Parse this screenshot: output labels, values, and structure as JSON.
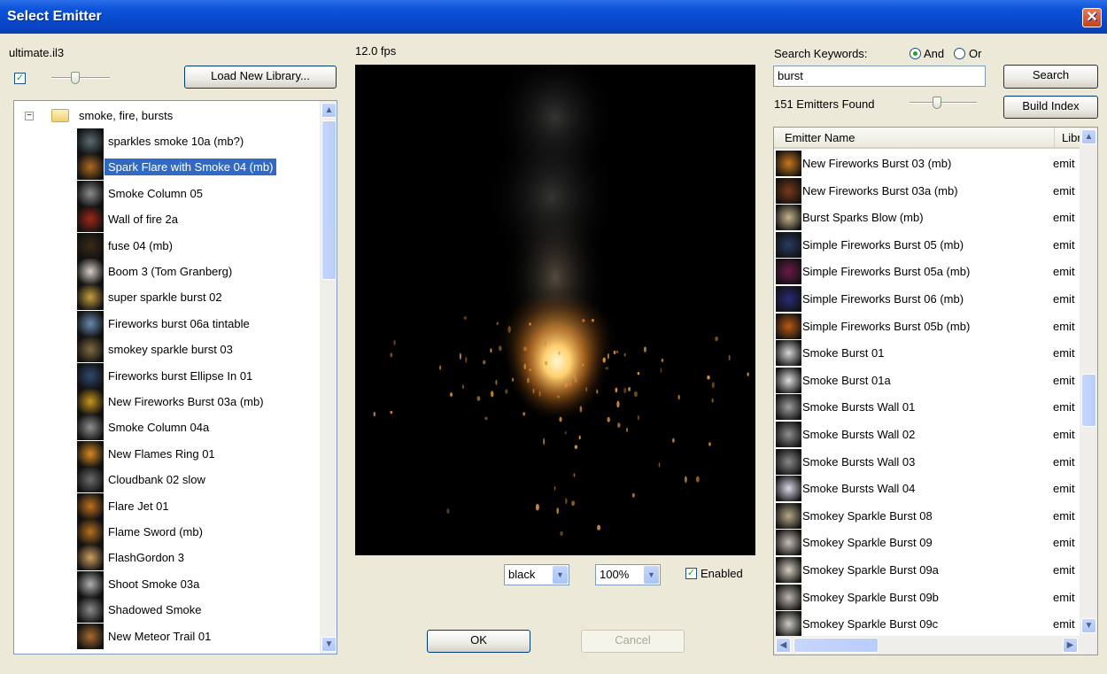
{
  "window": {
    "title": "Select Emitter",
    "close_glyph": "✕"
  },
  "library": {
    "file_name": "ultimate.il3",
    "show_thumbnails_checked": true,
    "thumbnail_size_level": 0.4,
    "load_button": "Load New Library...",
    "folder": {
      "label": "smoke, fire, bursts",
      "expanded": true
    },
    "items": [
      {
        "label": "sparkles smoke 10a (mb?)",
        "thumb": "#5b6c74"
      },
      {
        "label": "Spark Flare with Smoke 04 (mb)",
        "thumb": "#b06a22",
        "selected": true
      },
      {
        "label": "Smoke Column 05",
        "thumb": "#8c8c8c"
      },
      {
        "label": "Wall of fire 2a",
        "thumb": "#a02818"
      },
      {
        "label": "fuse 04 (mb)",
        "thumb": "#3a2a18"
      },
      {
        "label": "Boom 3 (Tom Granberg)",
        "thumb": "#d8d0c4"
      },
      {
        "label": "super sparkle burst 02",
        "thumb": "#c8a040"
      },
      {
        "label": "Fireworks burst 06a tintable",
        "thumb": "#6a8ab0"
      },
      {
        "label": "smokey sparkle burst 03",
        "thumb": "#806a40"
      },
      {
        "label": "Fireworks burst Ellipse In 01",
        "thumb": "#304a70"
      },
      {
        "label": "New Fireworks Burst 03a (mb)",
        "thumb": "#c8961e"
      },
      {
        "label": "Smoke Column 04a",
        "thumb": "#909090"
      },
      {
        "label": "New Flames Ring 01",
        "thumb": "#d88a20"
      },
      {
        "label": "Cloudbank 02 slow",
        "thumb": "#6c6c6c"
      },
      {
        "label": "Flare Jet 01",
        "thumb": "#c07020"
      },
      {
        "label": "Flame Sword  (mb)",
        "thumb": "#b87020"
      },
      {
        "label": "FlashGordon 3",
        "thumb": "#d0a060"
      },
      {
        "label": "Shoot Smoke 03a",
        "thumb": "#b0b0b0"
      },
      {
        "label": "Shadowed Smoke",
        "thumb": "#8a8a8a"
      },
      {
        "label": "New Meteor Trail 01",
        "thumb": "#a86a30"
      }
    ]
  },
  "preview": {
    "fps": "12.0 fps",
    "background_select": "black",
    "zoom_select": "100%",
    "enabled_label": "Enabled",
    "enabled_checked": true
  },
  "dialog_buttons": {
    "ok": "OK",
    "cancel": "Cancel"
  },
  "search": {
    "keywords_label": "Search Keywords:",
    "and_label": "And",
    "or_label": "Or",
    "mode": "And",
    "query": "burst",
    "search_button": "Search",
    "found_text": "151 Emitters Found",
    "thumbnail_size_level": 0.4,
    "build_index_button": "Build Index"
  },
  "results": {
    "columns": [
      "Emitter Name",
      "Libr"
    ],
    "rows": [
      {
        "name": "New Fireworks Burst 03 (mb)",
        "lib": "emit",
        "thumb": "#c8781e"
      },
      {
        "name": "New Fireworks Burst 03a (mb)",
        "lib": "emit",
        "thumb": "#7a3a18"
      },
      {
        "name": "Burst Sparks Blow (mb)",
        "lib": "emit",
        "thumb": "#c8b48c"
      },
      {
        "name": "Simple Fireworks Burst 05 (mb)",
        "lib": "emit",
        "thumb": "#283c64"
      },
      {
        "name": "Simple Fireworks Burst 05a (mb)",
        "lib": "emit",
        "thumb": "#6a1a4a"
      },
      {
        "name": "Simple Fireworks Burst 06 (mb)",
        "lib": "emit",
        "thumb": "#2a2a7a"
      },
      {
        "name": "Simple Fireworks Burst 05b (mb)",
        "lib": "emit",
        "thumb": "#b85a14"
      },
      {
        "name": "Smoke Burst 01",
        "lib": "emit",
        "thumb": "#d8d8d8"
      },
      {
        "name": "Smoke Burst 01a",
        "lib": "emit",
        "thumb": "#e0e0e0"
      },
      {
        "name": "Smoke Bursts Wall 01",
        "lib": "emit",
        "thumb": "#a0a0a0"
      },
      {
        "name": "Smoke Bursts Wall 02",
        "lib": "emit",
        "thumb": "#909090"
      },
      {
        "name": "Smoke Bursts Wall 03",
        "lib": "emit",
        "thumb": "#8a8a8a"
      },
      {
        "name": "Smoke Bursts Wall 04",
        "lib": "emit",
        "thumb": "#dedaea"
      },
      {
        "name": "Smokey Sparkle Burst 08",
        "lib": "emit",
        "thumb": "#b8a888"
      },
      {
        "name": "Smokey Sparkle Burst 09",
        "lib": "emit",
        "thumb": "#c8c0b8"
      },
      {
        "name": "Smokey Sparkle Burst 09a",
        "lib": "emit",
        "thumb": "#d8d0c0"
      },
      {
        "name": "Smokey Sparkle Burst 09b",
        "lib": "emit",
        "thumb": "#c0b8b0"
      },
      {
        "name": "Smokey Sparkle Burst 09c",
        "lib": "emit",
        "thumb": "#d0ccc4"
      }
    ]
  },
  "colors": {
    "titlebar": "#0846c8",
    "selection": "#316ac5",
    "dialog_bg": "#ece9d8",
    "checkmark": "#21a121"
  }
}
